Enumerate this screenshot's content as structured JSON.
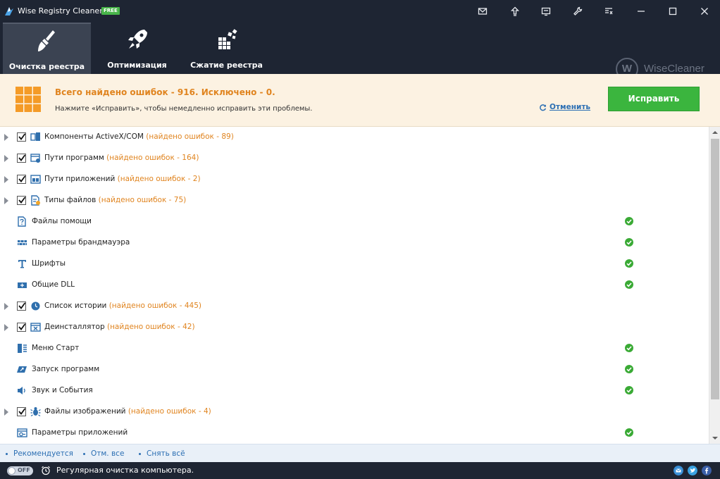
{
  "window": {
    "title": "Wise Registry Cleaner X",
    "badge": "FREE"
  },
  "tabs": [
    {
      "label": "Очистка реестра",
      "icon": "broom-icon",
      "active": true
    },
    {
      "label": "Оптимизация",
      "icon": "rocket-icon",
      "active": false
    },
    {
      "label": "Сжатие реестра",
      "icon": "compress-blocks-icon",
      "active": false
    }
  ],
  "brand": {
    "letter": "W",
    "name": "WiseCleaner"
  },
  "banner": {
    "title": "Всего найдено ошибок - 916. Исключено - 0.",
    "subtitle": "Нажмите «Исправить», чтобы немедленно исправить эти проблемы.",
    "undo_label": "Отменить",
    "fix_label": "Исправить"
  },
  "items": [
    {
      "label": "Компоненты ActiveX/COM",
      "errors": "(найдено ошибок - 89)",
      "expandable": true,
      "checked": true,
      "icon": "activex-icon",
      "ok": false
    },
    {
      "label": "Пути программ",
      "errors": "(найдено ошибок - 164)",
      "expandable": true,
      "checked": true,
      "icon": "program-path-icon",
      "ok": false
    },
    {
      "label": "Пути приложений",
      "errors": "(найдено ошибок - 2)",
      "expandable": true,
      "checked": true,
      "icon": "app-path-icon",
      "ok": false
    },
    {
      "label": "Типы файлов",
      "errors": "(найдено ошибок - 75)",
      "expandable": true,
      "checked": true,
      "icon": "file-type-icon",
      "ok": false
    },
    {
      "label": "Файлы помощи",
      "errors": "",
      "expandable": false,
      "checked": false,
      "icon": "help-file-icon",
      "ok": true
    },
    {
      "label": "Параметры брандмауэра",
      "errors": "",
      "expandable": false,
      "checked": false,
      "icon": "firewall-icon",
      "ok": true
    },
    {
      "label": "Шрифты",
      "errors": "",
      "expandable": false,
      "checked": false,
      "icon": "font-icon",
      "ok": true
    },
    {
      "label": "Общие DLL",
      "errors": "",
      "expandable": false,
      "checked": false,
      "icon": "dll-icon",
      "ok": true
    },
    {
      "label": "Список истории",
      "errors": "(найдено ошибок - 445)",
      "expandable": true,
      "checked": true,
      "icon": "history-icon",
      "ok": false
    },
    {
      "label": "Деинсталлятор",
      "errors": "(найдено ошибок - 42)",
      "expandable": true,
      "checked": true,
      "icon": "uninstaller-icon",
      "ok": false
    },
    {
      "label": "Меню Старт",
      "errors": "",
      "expandable": false,
      "checked": false,
      "icon": "start-menu-icon",
      "ok": true
    },
    {
      "label": "Запуск программ",
      "errors": "",
      "expandable": false,
      "checked": false,
      "icon": "startup-icon",
      "ok": true
    },
    {
      "label": "Звук и События",
      "errors": "",
      "expandable": false,
      "checked": false,
      "icon": "sound-icon",
      "ok": true
    },
    {
      "label": "Файлы изображений",
      "errors": "(найдено ошибок - 4)",
      "expandable": true,
      "checked": true,
      "icon": "image-file-icon",
      "ok": false
    },
    {
      "label": "Параметры приложений",
      "errors": "",
      "expandable": false,
      "checked": false,
      "icon": "app-settings-icon",
      "ok": true
    }
  ],
  "selection": {
    "recommended": "Рекомендуется",
    "select_all": "Отм. все",
    "deselect_all": "Снять всё"
  },
  "status": {
    "toggle_label": "OFF",
    "text": "Регулярная очистка компьютера."
  },
  "colors": {
    "titlebar": "#1e2533",
    "accent_orange": "#e0841f",
    "fix_green": "#3bb53e",
    "link_blue": "#2c6fb3",
    "ok_green": "#3aaa35"
  }
}
